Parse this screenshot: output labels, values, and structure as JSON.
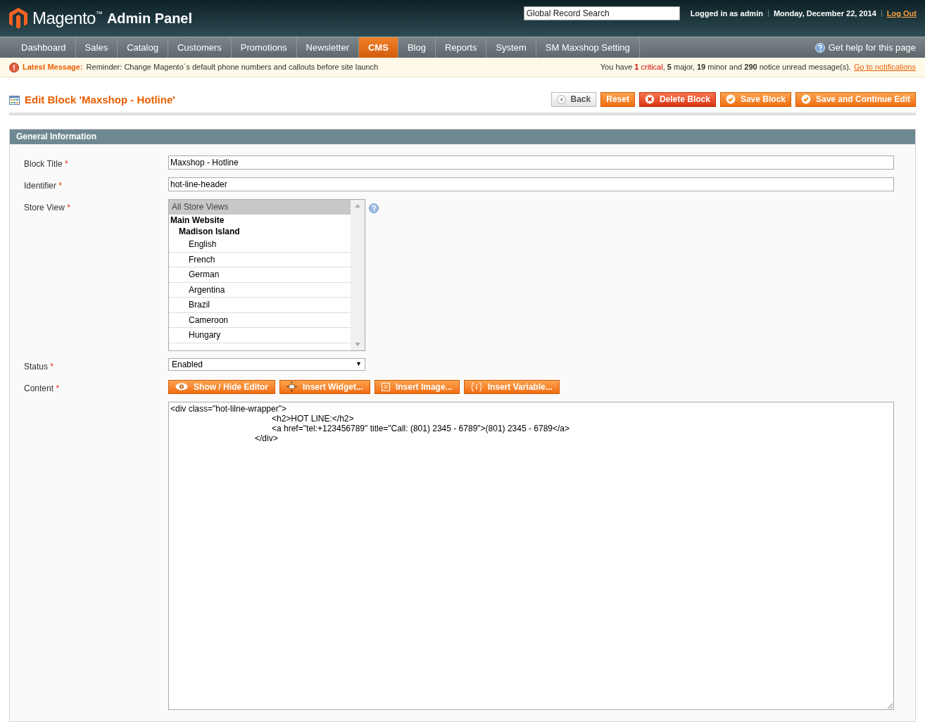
{
  "header": {
    "logo_text": "Magento",
    "logo_tm": "™",
    "logo_sub": "Admin Panel",
    "search": {
      "placeholder": "Global Record Search"
    },
    "user": "Logged in as admin",
    "date": "Monday, December 22, 2014",
    "logout": "Log Out"
  },
  "nav": {
    "items": [
      {
        "label": "Dashboard",
        "selected": false
      },
      {
        "label": "Sales",
        "selected": false
      },
      {
        "label": "Catalog",
        "selected": false
      },
      {
        "label": "Customers",
        "selected": false
      },
      {
        "label": "Promotions",
        "selected": false
      },
      {
        "label": "Newsletter",
        "selected": false
      },
      {
        "label": "CMS",
        "selected": true
      },
      {
        "label": "Blog",
        "selected": false
      },
      {
        "label": "Reports",
        "selected": false
      },
      {
        "label": "System",
        "selected": false
      },
      {
        "label": "SM Maxshop Setting",
        "selected": false
      }
    ],
    "help": "Get help for this page"
  },
  "message": {
    "label": "Latest Message:",
    "text": "Reminder: Change Magento`s default phone numbers and callouts before site launch",
    "summary": [
      {
        "kind": "plain",
        "text": "You have "
      },
      {
        "kind": "critical",
        "text": "1"
      },
      {
        "kind": "critical_label",
        "text": "critical"
      },
      {
        "kind": "plain",
        "text": ", "
      },
      {
        "kind": "bold",
        "text": "5"
      },
      {
        "kind": "plain",
        "text": " major, "
      },
      {
        "kind": "bold",
        "text": "19"
      },
      {
        "kind": "plain",
        "text": " minor and "
      },
      {
        "kind": "bold",
        "text": "290"
      },
      {
        "kind": "plain",
        "text": " notice unread message(s)."
      }
    ],
    "link": "Go to notifications"
  },
  "page": {
    "title": "Edit Block 'Maxshop - Hotline'",
    "buttons": [
      {
        "kind": "back",
        "label": "Back"
      },
      {
        "kind": "plain",
        "label": "Reset"
      },
      {
        "kind": "delete",
        "label": "Delete Block"
      },
      {
        "kind": "save",
        "label": "Save Block"
      },
      {
        "kind": "save",
        "label": "Save and Continue Edit"
      }
    ]
  },
  "section": {
    "title": "General Information",
    "required_mark": "*",
    "block_title": {
      "label": "Block Title",
      "value": "Maxshop - Hotline"
    },
    "identifier": {
      "label": "Identifier",
      "value": "hot-line-header"
    },
    "store_view": {
      "label": "Store View",
      "options": [
        {
          "label": "All Store Views",
          "selected": true
        },
        {
          "label": "Main Website",
          "children": [
            {
              "label": "Madison Island",
              "children": [
                {
                  "label": "English",
                  "selected": false
                },
                {
                  "label": "French",
                  "selected": false
                },
                {
                  "label": "German",
                  "selected": false
                },
                {
                  "label": "Argentina",
                  "selected": false
                },
                {
                  "label": "Brazil",
                  "selected": false
                },
                {
                  "label": "Cameroon",
                  "selected": false
                },
                {
                  "label": "Hungary",
                  "selected": false
                }
              ]
            }
          ]
        }
      ]
    },
    "status": {
      "label": "Status",
      "value": "Enabled",
      "arrow": "▼"
    },
    "content": {
      "label": "Content",
      "buttons": [
        {
          "kind": "eye",
          "label": "Show / Hide Editor"
        },
        {
          "kind": "widget",
          "label": "Insert Widget..."
        },
        {
          "kind": "image",
          "label": "Insert Image..."
        },
        {
          "kind": "variable",
          "label": "Insert Variable..."
        }
      ],
      "value": "<div class=\"hot-lilne-wrapper\">\n\t\t\t\t\t\t<h2>HOT LINE:</h2>\n\t\t\t\t\t\t<a href=\"tel:+123456789\" title=\"Call: (801) 2345 - 6789\">(801) 2345 - 6789</a>\n\t\t\t\t\t</div>"
    }
  }
}
